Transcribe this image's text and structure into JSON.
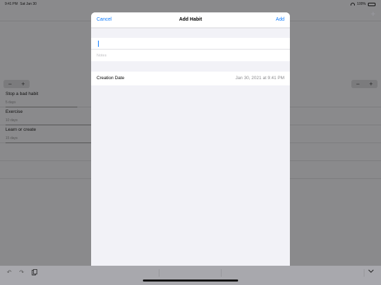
{
  "status_bar": {
    "time": "9:41 PM",
    "date": "Sat Jan 30",
    "battery": "100%",
    "battery_level": 1.0
  },
  "background": {
    "add_icon": "+",
    "stepper": {
      "minus": "−",
      "plus": "+"
    },
    "habits": [
      {
        "name": "Stop a bad habit",
        "days": "5 days",
        "progress": 0.8
      },
      {
        "name": "Exercise",
        "days": "10 days",
        "progress": 1.0
      },
      {
        "name": "Learn or create",
        "days": "15 days",
        "progress": 1.0
      }
    ]
  },
  "modal": {
    "cancel_label": "Cancel",
    "title": "Add Habit",
    "add_label": "Add",
    "name_field": {
      "value": "",
      "placeholder": ""
    },
    "notes_field": {
      "value": "",
      "placeholder": "Notes"
    },
    "creation_date": {
      "label": "Creation Date",
      "value": "Jan 30, 2021 at 9:41 PM"
    }
  },
  "toolbar": {
    "icons": [
      "undo-icon",
      "redo-icon",
      "paste-icon",
      "chevron-down-icon"
    ]
  },
  "colors": {
    "accent": "#0a7aff",
    "modal_background": "#f2f2f7",
    "dim_overlay": "#8a8a8c"
  }
}
